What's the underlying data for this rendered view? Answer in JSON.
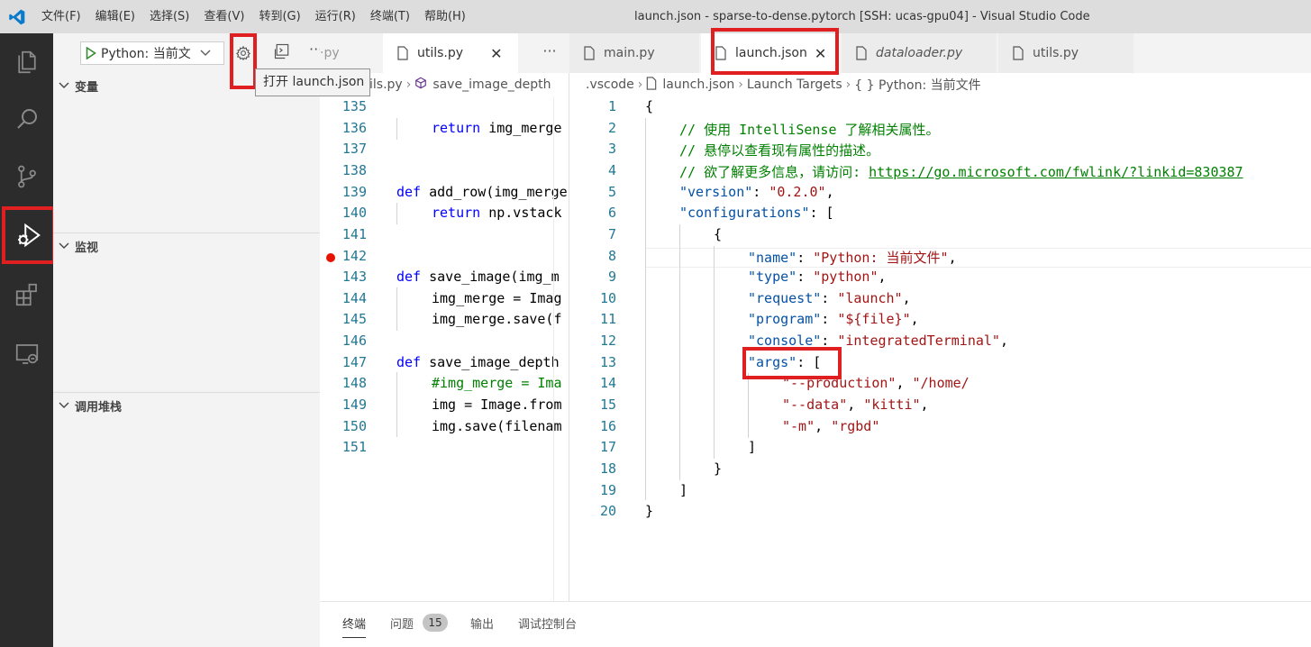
{
  "window": {
    "title": "launch.json - sparse-to-dense.pytorch [SSH: ucas-gpu04] - Visual Studio Code",
    "menu": [
      "文件(F)",
      "编辑(E)",
      "选择(S)",
      "查看(V)",
      "转到(G)",
      "运行(R)",
      "终端(T)",
      "帮助(H)"
    ]
  },
  "activity_bar": {
    "items": [
      "files-icon",
      "search-icon",
      "source-control-icon",
      "run-debug-icon",
      "extensions-icon",
      "remote-explorer-icon"
    ],
    "active": "run-debug-icon"
  },
  "debug": {
    "config_label": "Python: 当前文",
    "tooltip": "打开 launch.json",
    "sections": {
      "variables": "变量",
      "watch": "监视",
      "call_stack": "调用堆栈"
    }
  },
  "tabs_left": [
    {
      "label": "·py"
    },
    {
      "label": "utils.py"
    }
  ],
  "tabs_right": [
    {
      "label": "main.py"
    },
    {
      "label": "launch.json"
    },
    {
      "label": "dataloader.py"
    },
    {
      "label": "utils.py"
    }
  ],
  "breadcrumb_left": {
    "file": "ils.py",
    "symbol": "save_image_depth"
  },
  "breadcrumb_right": {
    "folder": ".vscode",
    "file": "launch.json",
    "node1": "Launch Targets",
    "node2": "{ } Python: 当前文件"
  },
  "left_code": {
    "line_numbers": [
      "135",
      "136",
      "137",
      "138",
      "139",
      "140",
      "141",
      "142",
      "143",
      "144",
      "145",
      "146",
      "147",
      "148",
      "149",
      "150",
      "151"
    ],
    "lines": {
      "l136_kw": "return",
      "l136_rest": " img_merge",
      "l139_kw": "def",
      "l139_rest": " add_row(img_merge",
      "l140_kw": "return",
      "l140_rest": " np.vstack",
      "l143_kw": "def",
      "l143_rest": " save_image(img_m",
      "l144": "img_merge = Imag",
      "l145": "img_merge.save(f",
      "l147_kw": "def",
      "l147_rest": " save_image_depth",
      "l148": "#img_merge = Ima",
      "l149": "img = Image.from",
      "l150": "img.save(filenam"
    }
  },
  "right_code": {
    "line_numbers": [
      "1",
      "2",
      "3",
      "4",
      "5",
      "6",
      "7",
      "8",
      "9",
      "10",
      "11",
      "12",
      "13",
      "14",
      "15",
      "16",
      "17",
      "18",
      "19",
      "20"
    ],
    "comment2": "// 使用 IntelliSense 了解相关属性。",
    "comment3": "// 悬停以查看现有属性的描述。",
    "comment4": "// 欲了解更多信息，请访问: ",
    "link4": "https://go.microsoft.com/fwlink/?linkid=830387",
    "version_key": "\"version\"",
    "version_val": "\"0.2.0\"",
    "configs_key": "\"configurations\"",
    "name_key": "\"name\"",
    "name_val": "\"Python: 当前文件\"",
    "type_key": "\"type\"",
    "type_val": "\"python\"",
    "request_key": "\"request\"",
    "request_val": "\"launch\"",
    "program_key": "\"program\"",
    "program_val": "\"${file}\"",
    "console_key": "\"console\"",
    "console_val": "\"integratedTerminal\"",
    "args_key": "\"args\"",
    "arg1": "\"--production\"",
    "arg2": "\"/home/",
    "arg3": "\"--data\"",
    "arg4": "\"kitti\"",
    "arg5": "\"-m\"",
    "arg6": "\"rgbd\""
  },
  "panel": {
    "tabs": [
      "终端",
      "问题",
      "输出",
      "调试控制台"
    ],
    "problems_count": "15"
  },
  "colors": {
    "highlight_red": "#e02020",
    "activity_bar": "#2c2c2c",
    "keyword": "#0000ff",
    "string": "#a31515",
    "property": "#0451a5",
    "comment": "#008000"
  }
}
